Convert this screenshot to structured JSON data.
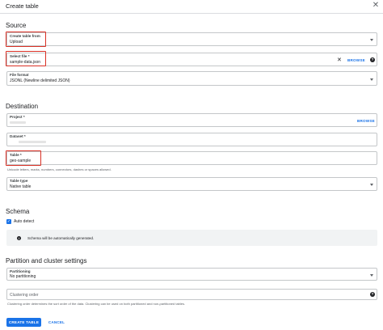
{
  "dialog": {
    "title": "Create table"
  },
  "source": {
    "heading": "Source",
    "create_from": {
      "label": "Create table from",
      "value": "Upload"
    },
    "select_file": {
      "label": "Select file *",
      "value": "sample-data.json",
      "browse": "BROWSE"
    },
    "file_format": {
      "label": "File format",
      "value": "JSONL (Newline delimited JSON)"
    }
  },
  "destination": {
    "heading": "Destination",
    "project": {
      "label": "Project *",
      "browse": "BROWSE"
    },
    "dataset": {
      "label": "Dataset *"
    },
    "table": {
      "label": "Table *",
      "value": "geo-sample",
      "hint": "Unicode letters, marks, numbers, connectors, dashes or spaces allowed."
    },
    "table_type": {
      "label": "Table type",
      "value": "Native table"
    }
  },
  "schema": {
    "heading": "Schema",
    "auto_detect_label": "Auto detect",
    "auto_detect_checked": true,
    "info": "Schema will be automatically generated."
  },
  "partition": {
    "heading": "Partition and cluster settings",
    "partitioning": {
      "label": "Partitioning",
      "value": "No partitioning"
    },
    "clustering": {
      "placeholder": "Clustering order",
      "hint": "Clustering order determines the sort order of the data. Clustering can be used on both partitioned and non-partitioned tables."
    }
  },
  "actions": {
    "create": "CREATE TABLE",
    "cancel": "CANCEL"
  },
  "colors": {
    "accent": "#1a73e8",
    "highlight": "#d93025",
    "border": "#c4c7c9"
  },
  "icons": {
    "close": "close-icon",
    "clear": "clear-icon",
    "help": "help-icon",
    "dropdown": "chevron-down-icon",
    "info": "info-icon",
    "check": "check-icon"
  }
}
